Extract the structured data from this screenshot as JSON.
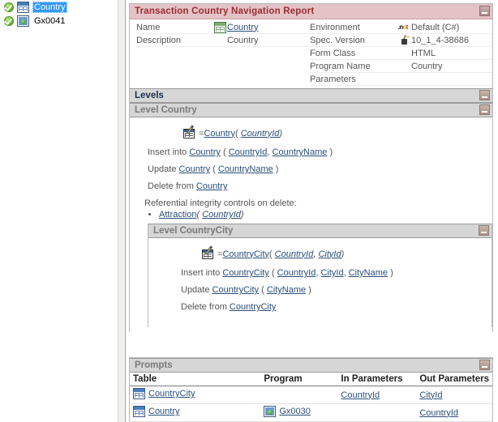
{
  "tree": {
    "items": [
      {
        "label": "Country",
        "icon": "transaction-icon",
        "status_icon": "check-circle-icon",
        "selected": true
      },
      {
        "label": "Gx0041",
        "icon": "webpanel-icon",
        "status_icon": "check-circle-icon",
        "selected": false
      }
    ]
  },
  "report": {
    "title": "Transaction Country Navigation Report",
    "collapse_label": "",
    "meta_left": [
      {
        "label": "Name",
        "icon": "transaction-icon",
        "value": "Country",
        "link": true
      },
      {
        "label": "Description",
        "icon": "",
        "value": "Country",
        "link": false
      }
    ],
    "meta_right": [
      {
        "label": "Environment",
        "icon": "dotnet-icon",
        "value": "Default (C#)"
      },
      {
        "label": "Spec. Version",
        "icon": "spec-tool-icon",
        "value": "10_1_4-38686"
      },
      {
        "label": "Form Class",
        "icon": "",
        "value": "HTML"
      },
      {
        "label": "Program Name",
        "icon": "",
        "value": "Country"
      },
      {
        "label": "Parameters",
        "icon": "",
        "value": ""
      }
    ],
    "levels_section": {
      "title": "Levels",
      "level_country": {
        "title": "Level Country",
        "equation": {
          "prefix": "=",
          "table": "Country",
          "open": "( ",
          "keys": [
            "CountryId"
          ],
          "close": ")"
        },
        "statements": [
          {
            "verb": "Insert into",
            "table": "Country",
            "open": "( ",
            "fields": [
              "CountryId",
              "CountryName"
            ],
            "close": " )"
          },
          {
            "verb": "Update",
            "table": "Country",
            "open": "( ",
            "fields": [
              "CountryName"
            ],
            "close": " )"
          },
          {
            "verb": "Delete from",
            "table": "Country",
            "open": "",
            "fields": [],
            "close": ""
          }
        ],
        "ri_title": "Referential integrity controls on delete:",
        "ri_items": [
          {
            "table": "Attraction",
            "open": "( ",
            "keys": [
              "CountryId"
            ],
            "close": ")"
          }
        ],
        "level_countrycity": {
          "title": "Level CountryCity",
          "equation": {
            "prefix": "=",
            "table": "CountryCity",
            "open": "( ",
            "keys": [
              "CountryId",
              "CityId"
            ],
            "close": ")"
          },
          "statements": [
            {
              "verb": "Insert into",
              "table": "CountryCity",
              "open": "( ",
              "fields": [
                "CountryId",
                "CityId",
                "CityName"
              ],
              "close": " )"
            },
            {
              "verb": "Update",
              "table": "CountryCity",
              "open": "( ",
              "fields": [
                "CityName"
              ],
              "close": " )"
            },
            {
              "verb": "Delete from",
              "table": "CountryCity",
              "open": "",
              "fields": [],
              "close": ""
            }
          ]
        }
      }
    },
    "prompts_section": {
      "title": "Prompts",
      "columns": [
        "Table",
        "Program",
        "In Parameters",
        "Out Parameters"
      ],
      "rows": [
        {
          "table": "CountryCity",
          "table_icon": "transaction-icon",
          "program": "",
          "program_icon": "",
          "in_parameters": "CountryId",
          "out_parameters": "CityId"
        },
        {
          "table": "Country",
          "table_icon": "transaction-icon",
          "program": "Gx0030",
          "program_icon": "webpanel-icon",
          "in_parameters": "",
          "out_parameters": "CountryId"
        }
      ]
    }
  },
  "colors": {
    "title_bg": "#e4c3c6",
    "title_fg": "#9b2c33",
    "section_bg": "#d6d6d6",
    "section_fg": "#7a7a7a",
    "section_fg_dark": "#1f2e4d",
    "link": "#2a4f7a",
    "selection": "#3399ff"
  }
}
